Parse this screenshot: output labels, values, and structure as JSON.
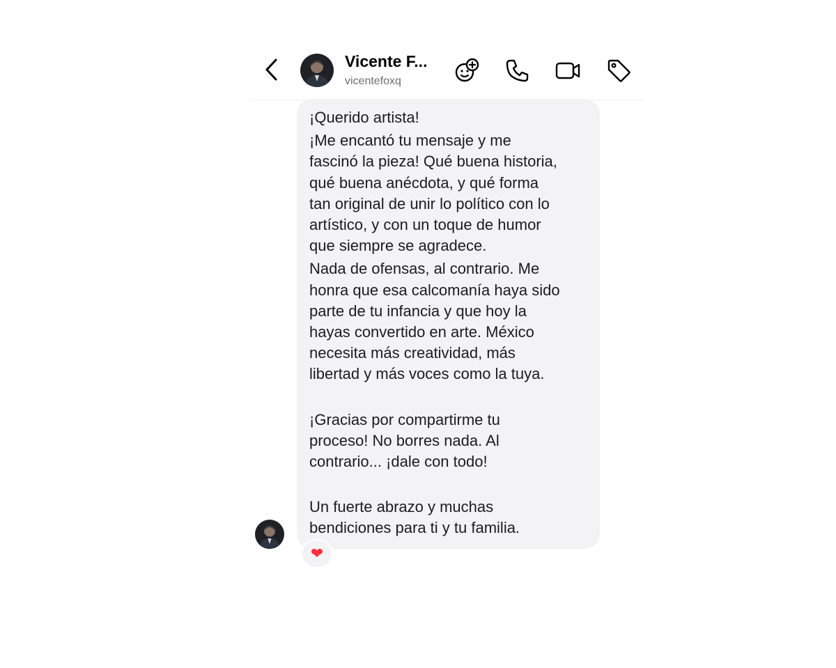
{
  "header": {
    "contact_name": "Vicente F...",
    "contact_handle": "vicentefoxq",
    "icons": [
      "back-icon",
      "add-sticker-icon",
      "phone-icon",
      "video-camera-icon",
      "tag-icon"
    ]
  },
  "message": {
    "paragraphs": [
      "¡Querido artista!",
      "¡Me encantó tu mensaje y me\nfascinó la pieza! Qué buena historia,\nqué buena anécdota, y qué forma\ntan original de unir lo político con lo\nartístico, y con un toque de humor\nque siempre se agradece.",
      "Nada de ofensas, al contrario. Me\nhonra que esa calcomanía haya sido\nparte de tu infancia y que hoy la\nhayas convertido en arte. México\nnecesita más creatividad, más\nlibertad y más voces como la tuya.",
      "¡Gracias por compartirme tu\nproceso! No borres nada. Al\ncontrario... ¡dale con todo!",
      "Un fuerte abrazo y muchas\nbendiciones para ti y tu familia."
    ],
    "reaction": "❤"
  },
  "colors": {
    "bubble_bg": "#f3f3f5",
    "text": "#1c1c1e",
    "handle_text": "#6e6e73",
    "reaction": "#ff2d3d"
  }
}
